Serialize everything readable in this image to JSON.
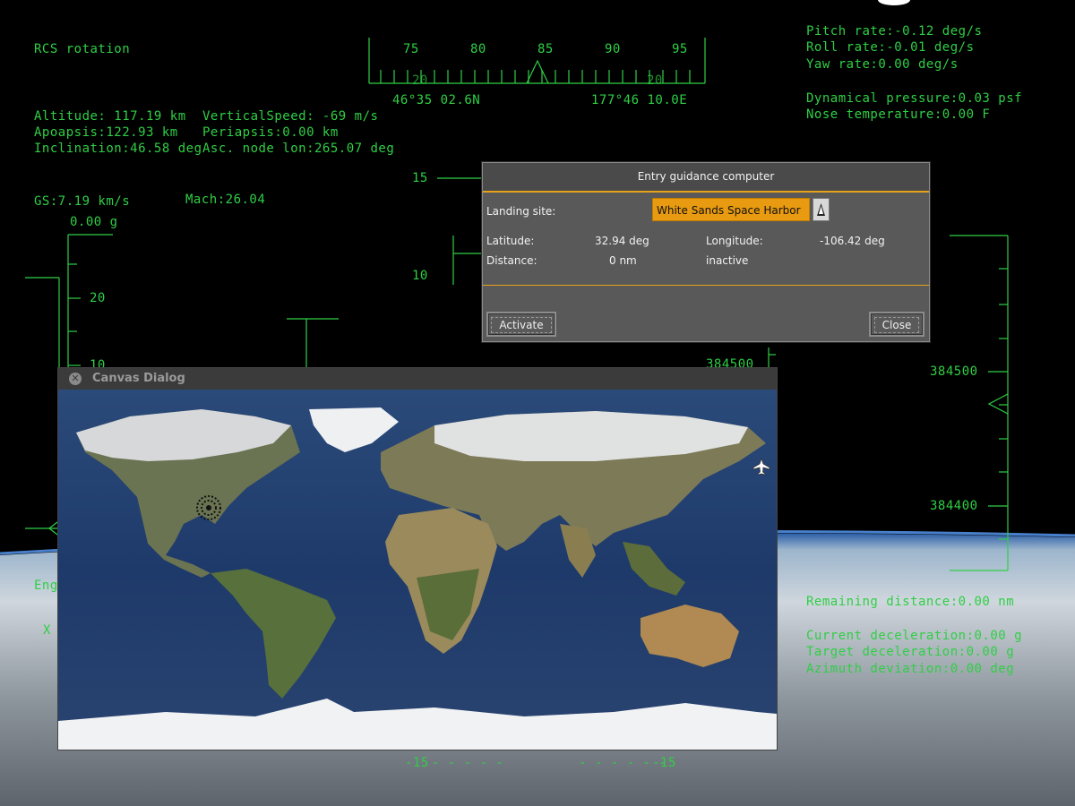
{
  "hud": {
    "rcs_rotation": "RCS rotation",
    "altitude": "Altitude: 117.19 km",
    "apoapsis": "Apoapsis:122.93 km",
    "inclination": "Inclination:46.58 deg",
    "vertical_speed": "VerticalSpeed: -69 m/s",
    "periapsis": "Periapsis:0.00 km",
    "asc_node": "Asc. node lon:265.07 deg",
    "gs": "GS:7.19 km/s",
    "gload": "0.00 g",
    "mach": "Mach:26.04",
    "pitch_rate": "Pitch rate:-0.12 deg/s",
    "roll_rate": "Roll rate:-0.01 deg/s",
    "yaw_rate": "Yaw rate:0.00 deg/s",
    "dyn_pressure": "Dynamical pressure:0.03 psf",
    "nose_temp": "Nose temperature:0.00 F",
    "remaining_distance": "Remaining distance:0.00 nm",
    "current_decel": "Current deceleration:0.00 g",
    "target_decel": "Target deceleration:0.00 g",
    "azimuth_dev": "Azimuth deviation:0.00 deg",
    "heading_ticks": [
      "75",
      "80",
      "85",
      "90",
      "95"
    ],
    "heading_pointer": "20",
    "heading_pointer_right": "20",
    "lat_readout": "46°35 02.6N",
    "lon_readout": "177°46 10.0E",
    "pitch_15": "15",
    "pitch_10": "10",
    "pitch_neg15_left": "-15",
    "pitch_neg15_right": "-15",
    "speed_20": "20",
    "speed_10": "10",
    "alt_384500_left": "384500",
    "alt_384500": "384500",
    "alt_384400": "384400",
    "eng_label": "Eng",
    "x_label": "X"
  },
  "egc": {
    "title": "Entry guidance computer",
    "landing_site_label": "Landing site:",
    "landing_site_value": "White Sands Space Harbor",
    "latitude_label": "Latitude:",
    "latitude_value": "32.94 deg",
    "longitude_label": "Longitude:",
    "longitude_value": "-106.42 deg",
    "distance_label": "Distance:",
    "distance_value": "0 nm",
    "status": "inactive",
    "activate": "Activate",
    "close": "Close"
  },
  "canvas_dialog": {
    "title": "Canvas Dialog",
    "close_icon": "close-icon"
  },
  "icons": [
    "close-icon",
    "aircraft-icon",
    "landing-site-icon",
    "dropdown-arrow-icon"
  ],
  "colors": {
    "hud_green": "#2fcf45",
    "accent_orange": "#e89a10"
  }
}
